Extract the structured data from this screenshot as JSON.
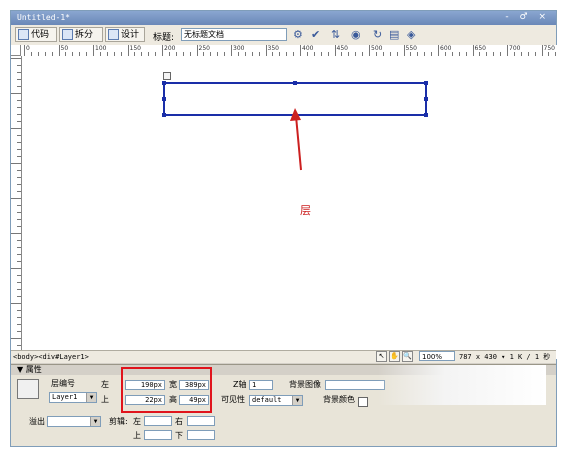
{
  "window": {
    "title": "Untitled-1*",
    "controls": "- ♂ ×"
  },
  "toolbar": {
    "code_label": "代码",
    "split_label": "拆分",
    "design_label": "设计",
    "title_label": "标题:",
    "title_value": "无标题文档"
  },
  "ruler": {
    "labels": [
      "0",
      "50",
      "100",
      "150",
      "200",
      "250",
      "300",
      "350",
      "400",
      "450",
      "500",
      "550",
      "600",
      "650",
      "700",
      "750"
    ]
  },
  "annotation": {
    "text": "层",
    "color": "#cc2020"
  },
  "layer": {
    "border_color": "#1a2ea8"
  },
  "statusbar": {
    "tag_path": "<body><div#Layer1>",
    "zoom": "100%",
    "dimensions": "787 x 430 ▾ 1 K / 1 秒"
  },
  "properties": {
    "header": "▼ 属性",
    "layer_id_label": "层编号",
    "layer_id_value": "Layer1",
    "left_label": "左",
    "left_value": "190px",
    "top_label": "上",
    "top_value": "22px",
    "width_label": "宽",
    "width_value": "389px",
    "height_label": "高",
    "height_value": "49px",
    "z_label": "Z轴",
    "z_value": "1",
    "bg_image_label": "背景图像",
    "visibility_label": "可见性",
    "visibility_value": "default",
    "bg_color_label": "背景颜色",
    "overflow_label": "溢出",
    "clip_label": "剪辑:",
    "clip_left_label": "左",
    "clip_right_label": "右",
    "clip_top_label": "上",
    "clip_bottom_label": "下",
    "highlight_color": "#e0141c"
  }
}
